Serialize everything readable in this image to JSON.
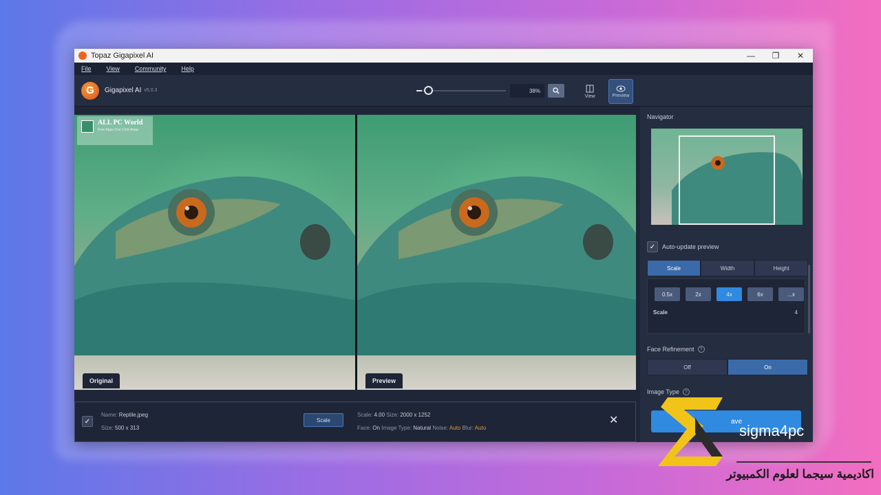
{
  "window": {
    "title": "Topaz Gigapixel AI",
    "controls": {
      "minimize": "—",
      "maximize": "❐",
      "close": "✕"
    }
  },
  "menu": {
    "items": [
      "File",
      "View",
      "Community",
      "Help"
    ]
  },
  "toolbar": {
    "logo_letter": "G",
    "app_name": "Gigapixel AI",
    "version": "v5.0.3",
    "zoom_value": "38%",
    "view_label": "View",
    "preview_label": "Preview"
  },
  "panes": {
    "left_label": "Original",
    "right_label": "Preview",
    "watermark_title": "ALL PC World",
    "watermark_sub": "Free Apps One Click Away"
  },
  "sidebar": {
    "navigator_title": "Navigator",
    "auto_update_label": "Auto-update preview",
    "auto_update_checked": true,
    "mode_tabs": [
      "Scale",
      "Width",
      "Height"
    ],
    "active_mode": "Scale",
    "scale_options": [
      "0.5x",
      "2x",
      "4x",
      "6x",
      "...x"
    ],
    "active_scale": "4x",
    "scale_label": "Scale",
    "scale_value": "4",
    "face_refinement_title": "Face Refinement",
    "face_options": [
      "Off",
      "On"
    ],
    "active_face": "On",
    "image_type_title": "Image Type",
    "save_label": "ave"
  },
  "bottom": {
    "name_label": "Name:",
    "name_value": "Reptile.jpeg",
    "size_label": "Size:",
    "size_value": "500 x 313",
    "scale_button": "Scale",
    "out_scale_label": "Scale:",
    "out_scale_value": "4.00",
    "out_size_label": "Size:",
    "out_size_value": "2000 x 1252",
    "face_label": "Face:",
    "face_value": "On",
    "imgtype_label": "Image Type:",
    "imgtype_value": "Natural",
    "noise_label": "Noise:",
    "noise_value": "Auto",
    "blur_label": "Blur:",
    "blur_value": "Auto",
    "close_icon": "✕"
  },
  "branding": {
    "name": "sigma4pc",
    "arabic": "اكاديمية سيجما لعلوم الكمبيوتر",
    "colors": {
      "gold": "#f2c318",
      "dark": "#2b2b2b"
    }
  }
}
